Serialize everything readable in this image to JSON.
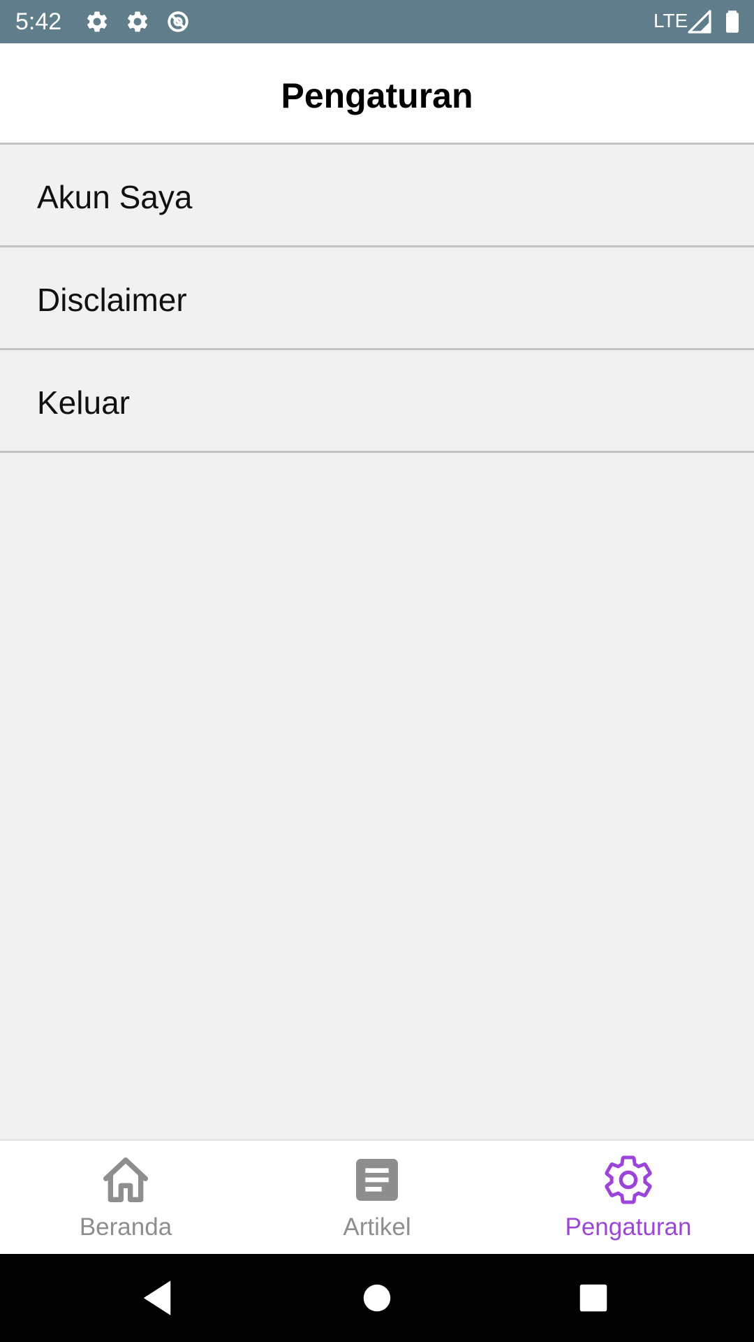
{
  "status_bar": {
    "time": "5:42",
    "network": "LTE",
    "icons": [
      "gear-icon",
      "gear-icon",
      "data-saver-icon",
      "signal-icon",
      "battery-icon"
    ],
    "background": "#607d8b"
  },
  "header": {
    "title": "Pengaturan"
  },
  "settings": {
    "items": [
      {
        "label": "Akun Saya"
      },
      {
        "label": "Disclaimer"
      },
      {
        "label": "Keluar"
      }
    ]
  },
  "bottom_nav": {
    "items": [
      {
        "label": "Beranda",
        "icon": "home-icon",
        "active": false
      },
      {
        "label": "Artikel",
        "icon": "article-icon",
        "active": false
      },
      {
        "label": "Pengaturan",
        "icon": "gear-icon",
        "active": true
      }
    ],
    "active_color": "#9b46d9",
    "inactive_color": "#8e8e8e"
  },
  "system_nav": {
    "buttons": [
      "back-icon",
      "home-circle-icon",
      "recents-icon"
    ]
  }
}
